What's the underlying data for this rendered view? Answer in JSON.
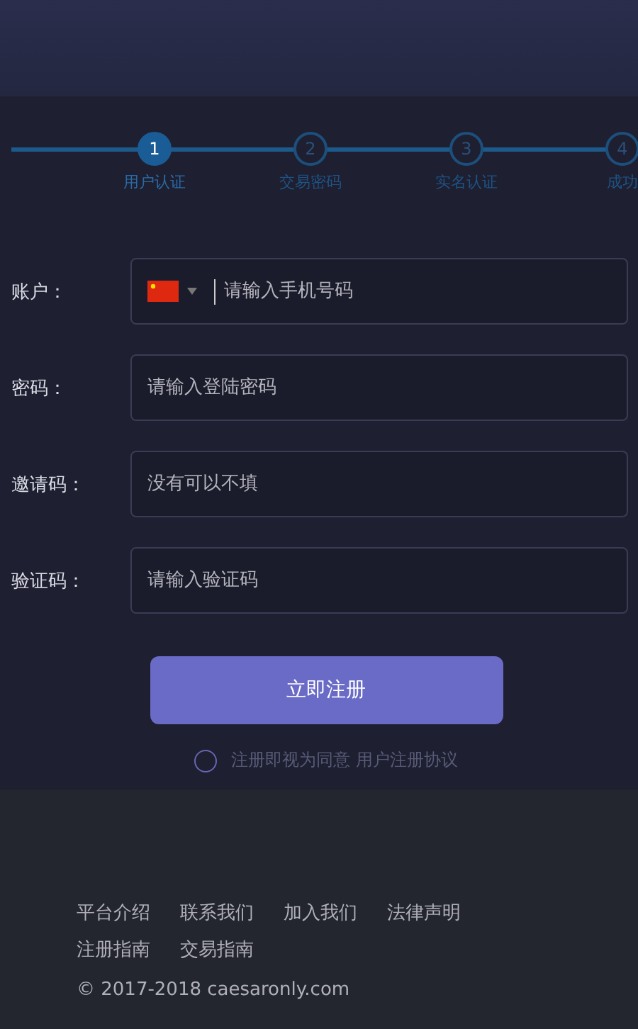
{
  "steps": [
    {
      "number": "1",
      "label": "用户认证",
      "selected": true
    },
    {
      "number": "2",
      "label": "交易密码",
      "selected": false
    },
    {
      "number": "3",
      "label": "实名认证",
      "selected": false
    },
    {
      "number": "4",
      "label": "成功",
      "selected": false
    }
  ],
  "form": {
    "fields": [
      {
        "label": "账户：",
        "placeholder": "请输入手机号码",
        "kind": "phone"
      },
      {
        "label": "密码：",
        "placeholder": "请输入登陆密码",
        "kind": "password"
      },
      {
        "label": "邀请码：",
        "placeholder": "没有可以不填",
        "kind": "text"
      },
      {
        "label": "验证码：",
        "placeholder": "请输入验证码",
        "kind": "text"
      }
    ],
    "submit": "立即注册",
    "agreement": {
      "text": "注册即视为同意 用户注册协议",
      "checked": false
    }
  },
  "footer": {
    "links": [
      "平台介绍",
      "联系我们",
      "加入我们",
      "法律声明",
      "注册指南",
      "交易指南"
    ],
    "copyright": "© 2017-2018 caesaronly.com"
  }
}
